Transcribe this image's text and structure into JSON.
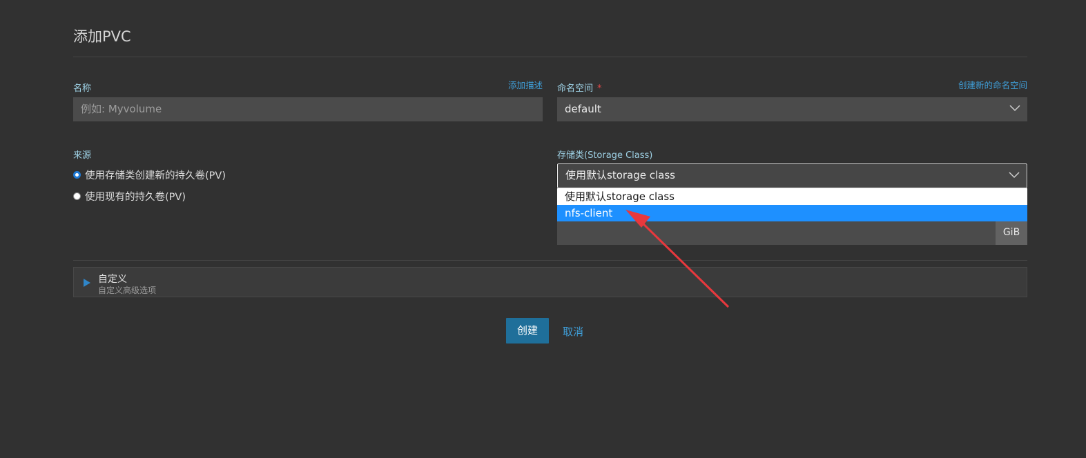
{
  "page": {
    "title": "添加PVC"
  },
  "name_field": {
    "label": "名称",
    "add_description_link": "添加描述",
    "placeholder": "例如: Myvolume"
  },
  "namespace": {
    "label": "命名空间",
    "required_mark": "*",
    "create_link": "创建新的命名空间",
    "value": "default"
  },
  "source": {
    "label": "来源",
    "options": [
      {
        "label": "使用存储类创建新的持久卷(PV)",
        "checked": true
      },
      {
        "label": "使用现有的持久卷(PV)",
        "checked": false
      }
    ]
  },
  "storage_class": {
    "label": "存储类(Storage Class)",
    "value": "使用默认storage class",
    "options": [
      "使用默认storage class",
      "nfs-client"
    ],
    "highlighted": "nfs-client"
  },
  "capacity": {
    "unit": "GiB"
  },
  "custom": {
    "title": "自定义",
    "subtitle": "自定义高级选项"
  },
  "actions": {
    "create": "创建",
    "cancel": "取消"
  },
  "colors": {
    "accent": "#1e90ff",
    "button": "#1f6f9a",
    "link": "#3f9ed8",
    "arrow": "#e8383d"
  }
}
